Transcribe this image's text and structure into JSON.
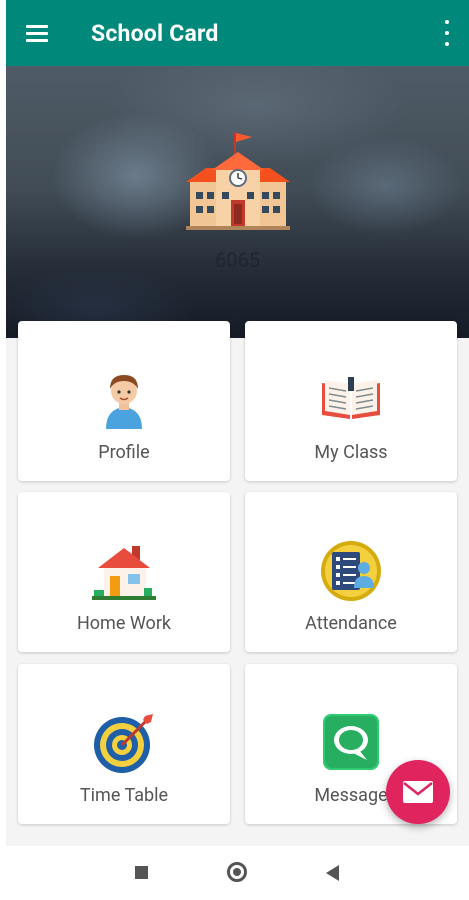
{
  "app_bar": {
    "title": "School Card",
    "background": "#00897b",
    "menu_icon": "hamburger-menu-icon",
    "overflow_icon": "more-vert-icon"
  },
  "header": {
    "icon": "school-building-icon",
    "school_code": "6065"
  },
  "tiles": [
    {
      "label": "Profile",
      "icon": "student-avatar-icon"
    },
    {
      "label": "My Class",
      "icon": "open-book-icon"
    },
    {
      "label": "Home Work",
      "icon": "house-icon"
    },
    {
      "label": "Attendance",
      "icon": "attendance-checklist-icon"
    },
    {
      "label": "Time Table",
      "icon": "target-dart-icon"
    },
    {
      "label": "Message",
      "icon": "chat-bubble-icon"
    }
  ],
  "fab": {
    "icon": "mail-envelope-icon",
    "color": "#e0245e"
  },
  "system_nav": {
    "recent_icon": "square-icon",
    "home_icon": "circle-icon",
    "back_icon": "triangle-back-icon"
  }
}
